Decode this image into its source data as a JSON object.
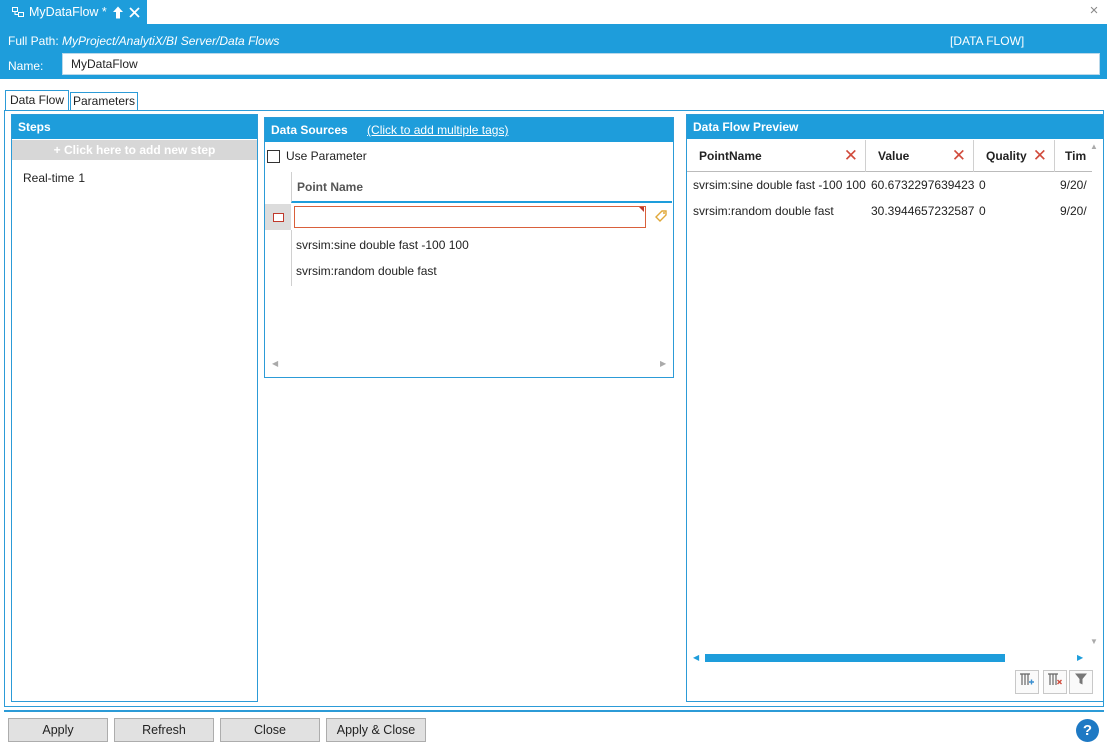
{
  "document_tab": {
    "title": "MyDataFlow *",
    "icons": [
      "dataflow-icon",
      "pin-icon",
      "close-icon"
    ]
  },
  "window": {
    "close_glyph": "×"
  },
  "header": {
    "full_path_label": "Full Path:",
    "full_path_value": "MyProject/AnalytiX/BI Server/Data Flows",
    "type_badge": "[DATA FLOW]",
    "name_label": "Name:",
    "name_value": "MyDataFlow"
  },
  "tabs": [
    {
      "label": "Data Flow",
      "active": true
    },
    {
      "label": "Parameters",
      "active": false
    }
  ],
  "steps": {
    "title": "Steps",
    "add_label": "+ Click here to add new step",
    "items": [
      {
        "name": "Real-time",
        "count": "1"
      }
    ]
  },
  "data_sources": {
    "title": "Data Sources",
    "link_label": "(Click to add multiple tags)",
    "use_parameter_label": "Use Parameter",
    "use_parameter_checked": false,
    "column_header": "Point Name",
    "input_value": "",
    "rows": [
      "svrsim:sine double fast -100 100",
      "svrsim:random double fast"
    ]
  },
  "preview": {
    "title": "Data Flow Preview",
    "columns": [
      "PointName",
      "Value",
      "Quality",
      "Tim"
    ],
    "rows": [
      [
        "svrsim:sine double fast -100 100",
        "60.6732297639423",
        "0",
        "9/20/"
      ],
      [
        "svrsim:random double fast",
        "30.3944657232587",
        "0",
        "9/20/"
      ]
    ],
    "toolbar": [
      "add-column-icon",
      "remove-column-icon",
      "filter-icon"
    ]
  },
  "footer": {
    "buttons": [
      "Apply",
      "Refresh",
      "Close",
      "Apply & Close"
    ],
    "help_glyph": "?"
  },
  "colors": {
    "accent": "#1e9ddb",
    "border": "#2c9bd7",
    "remove_icon": "#d14b3c",
    "help": "#1e79c4"
  }
}
